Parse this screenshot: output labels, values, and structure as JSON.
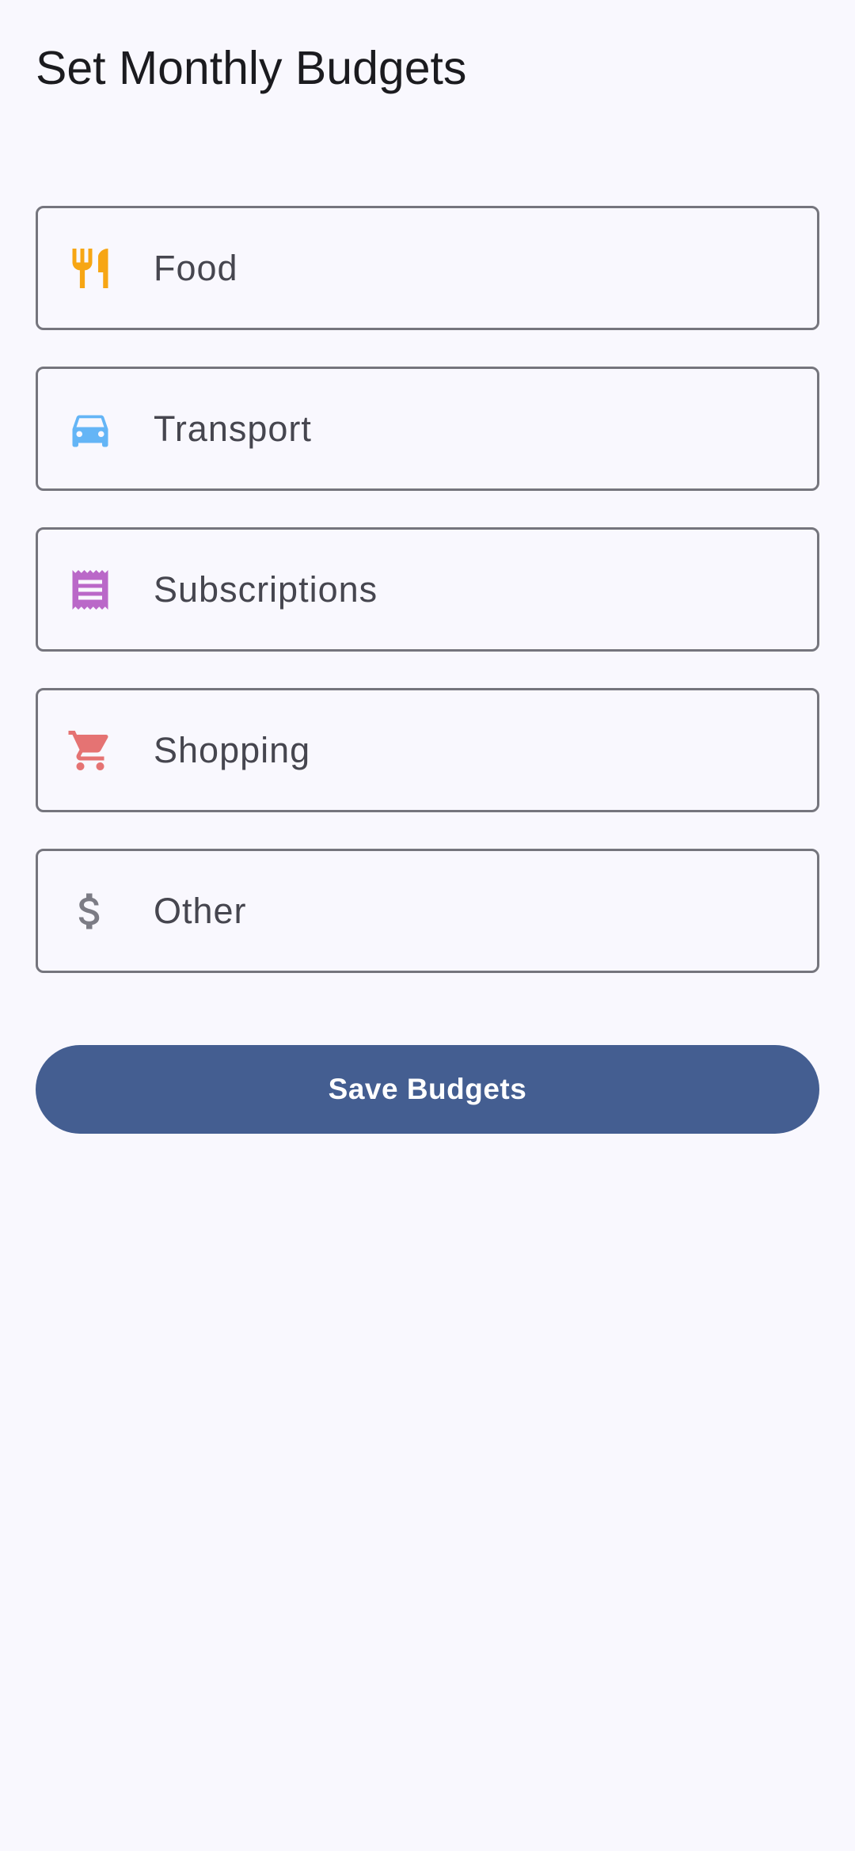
{
  "screen": {
    "title": "Set Monthly Budgets"
  },
  "categories": [
    {
      "label": "Food",
      "icon": "restaurant-icon",
      "color": "#f7a614",
      "value": ""
    },
    {
      "label": "Transport",
      "icon": "car-icon",
      "color": "#64b5f6",
      "value": ""
    },
    {
      "label": "Subscriptions",
      "icon": "receipt-icon",
      "color": "#ba68c8",
      "value": ""
    },
    {
      "label": "Shopping",
      "icon": "shopping-cart-icon",
      "color": "#e57373",
      "value": ""
    },
    {
      "label": "Other",
      "icon": "dollar-icon",
      "color": "#7c7c85",
      "value": ""
    }
  ],
  "actions": {
    "save_label": "Save Budgets"
  },
  "theme": {
    "primary": "#445e91",
    "background": "#f9f8fe",
    "outline": "#75757d"
  }
}
